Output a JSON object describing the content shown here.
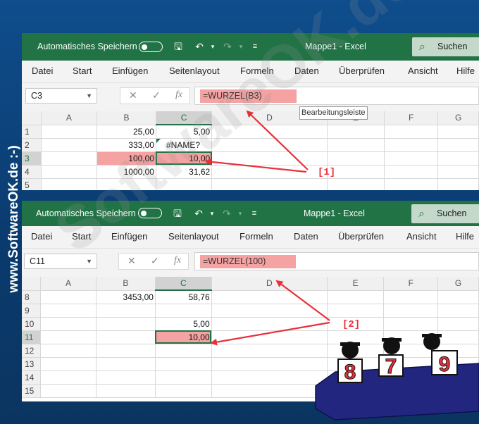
{
  "side_watermark": "www.SoftwareOK.de :-)",
  "diagonal_watermark": "SoftwareOK.de",
  "titlebar": {
    "autosave_label": "Automatisches Speichern",
    "title": "Mappe1  -  Excel",
    "search_label": "Suchen",
    "color": "#217346"
  },
  "ribbon_tabs": [
    "Datei",
    "Start",
    "Einfügen",
    "Seitenlayout",
    "Formeln",
    "Daten",
    "Überprüfen",
    "Ansicht",
    "Hilfe"
  ],
  "window1": {
    "namebox": "C3",
    "formula": "=WURZEL(B3)",
    "tooltip": "Bearbeitungsleiste",
    "columns": [
      "A",
      "B",
      "C",
      "D",
      "E",
      "F",
      "G"
    ],
    "rows": [
      {
        "n": "1",
        "b": "25,00",
        "c": "5,00"
      },
      {
        "n": "2",
        "b": "333,00",
        "c": "#NAME?"
      },
      {
        "n": "3",
        "b": "100,00",
        "c": "10,00"
      },
      {
        "n": "4",
        "b": "1000,00",
        "c": "31,62"
      },
      {
        "n": "5",
        "b": "",
        "c": ""
      }
    ],
    "marker": "[1]"
  },
  "window2": {
    "namebox": "C11",
    "formula": "=WURZEL(100)",
    "columns": [
      "A",
      "B",
      "C",
      "D",
      "E",
      "F",
      "G"
    ],
    "rows": [
      {
        "n": "8",
        "b": "3453,00",
        "c": "58,76"
      },
      {
        "n": "9",
        "b": "",
        "c": ""
      },
      {
        "n": "10",
        "b": "",
        "c": "5,00"
      },
      {
        "n": "11",
        "b": "",
        "c": "10,00"
      },
      {
        "n": "12",
        "b": "",
        "c": ""
      },
      {
        "n": "13",
        "b": "",
        "c": ""
      },
      {
        "n": "14",
        "b": "",
        "c": ""
      },
      {
        "n": "15",
        "b": "",
        "c": ""
      }
    ],
    "marker": "[2]"
  },
  "scores": [
    "8",
    "7",
    "9"
  ],
  "highlight_color": "#f4a2a2",
  "arrow_color": "#e8303a"
}
